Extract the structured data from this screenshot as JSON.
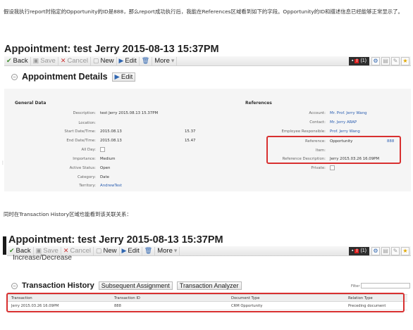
{
  "intro_text": "假设我执行report时指定的Opportunity的ID是888，那么report成功执行后，我能在References区域看到如下的字段。Opportunity的ID和描述信息已经能够正常显示了。",
  "second_text": "同时在Transaction History区域也能看到该关联关系：",
  "screen1": {
    "page_title": "Appointment: test Jerry 2015-08-13 15:37PM",
    "toolbar": {
      "back": "Back",
      "save": "Save",
      "cancel": "Cancel",
      "new": "New",
      "edit": "Edit",
      "more": "More",
      "badge": "(1)"
    },
    "section_title": "Appointment Details",
    "edit_button": "Edit",
    "general_data": {
      "title": "General Data",
      "labels": [
        "Description:",
        "Location:",
        "Start Date/Time:",
        "End Date/Time:",
        "All Day:",
        "Importance:",
        "Active Status:",
        "Category:",
        "Territory:"
      ],
      "description": "test Jerry 2015.08.13 15.37PM",
      "start_date": "2015.08.13",
      "start_time": "15.37",
      "end_date": "2015.08.13",
      "end_time": "15.47",
      "importance": "Medium",
      "active_status": "Open",
      "category": "Date",
      "territory": "AndrewTest"
    },
    "references": {
      "title": "References",
      "labels": [
        "Account:",
        "Contact:",
        "Employee Responsible:",
        "Reference:",
        "Item:",
        "Reference Description:",
        "Private:"
      ],
      "account": "Mr. Prof. Jerry Wang",
      "contact": "Mr. Jerry ARAP",
      "employee": "Prof. Jerry Wang",
      "reference": "Opportunity",
      "reference_id": "888",
      "reference_description": "Jerry 2015.03.26 16.09PM"
    }
  },
  "screen2": {
    "page_title": "Appointment: test Jerry 2015-08-13 15:37PM",
    "toolbar": {
      "back": "Back",
      "save": "Save",
      "cancel": "Cancel",
      "new": "New",
      "edit": "Edit",
      "more": "More",
      "badge": "(1)"
    },
    "partial_section": "Increase/Decrease",
    "section_title": "Transaction History",
    "tab_subsequent": "Subsequent Assignment",
    "tab_analyzer": "Transaction Analyzer",
    "filter_label": "Filter",
    "table": {
      "headers": [
        "Transaction",
        "Transaction ID",
        "Document Type",
        "Relation Type"
      ],
      "row": [
        "Jerry 2015.03.26 16.09PM",
        "888",
        "CRM Opportunity",
        "Preceding document"
      ]
    }
  },
  "colors": {
    "highlight": "#d83030",
    "link": "#2a5db0"
  }
}
